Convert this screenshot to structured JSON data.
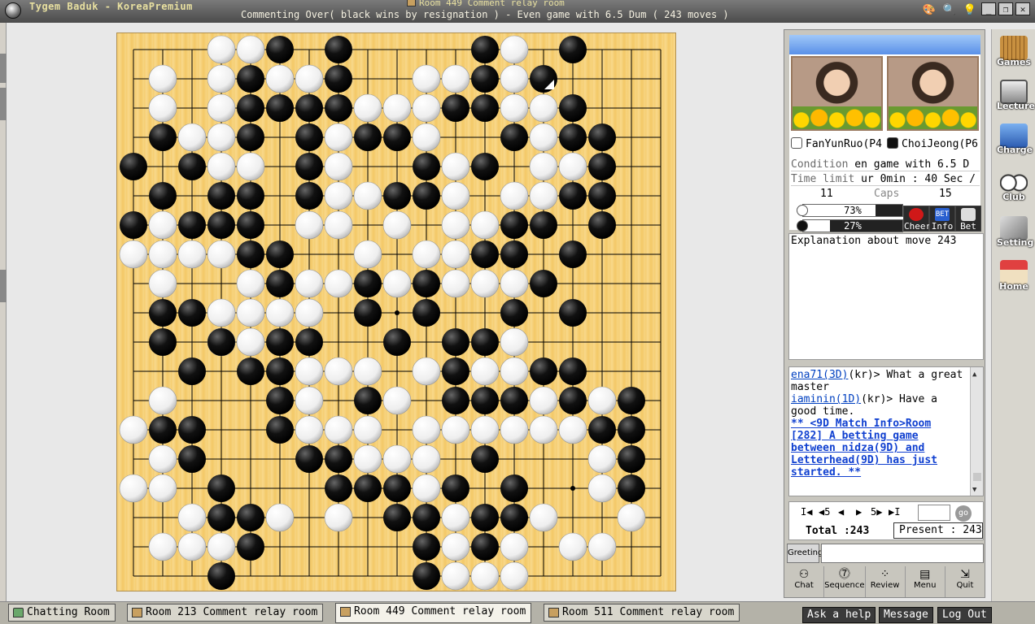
{
  "titlebar": {
    "app_title": "Tygem Baduk - KoreaPremium",
    "room_title": "Room 449 Comment relay room",
    "status": "Commenting Over( black wins by resignation ) - Even game with 6.5 Dum  ( 243 moves )"
  },
  "board": {
    "size": 19,
    "last_move": [
      14,
      1
    ],
    "black": [
      [
        5,
        0
      ],
      [
        7,
        0
      ],
      [
        12,
        0
      ],
      [
        15,
        0
      ],
      [
        4,
        1
      ],
      [
        7,
        1
      ],
      [
        12,
        1
      ],
      [
        14,
        1
      ],
      [
        4,
        2
      ],
      [
        5,
        2
      ],
      [
        6,
        2
      ],
      [
        7,
        2
      ],
      [
        11,
        2
      ],
      [
        12,
        2
      ],
      [
        15,
        2
      ],
      [
        1,
        3
      ],
      [
        4,
        3
      ],
      [
        6,
        3
      ],
      [
        8,
        3
      ],
      [
        9,
        3
      ],
      [
        13,
        3
      ],
      [
        15,
        3
      ],
      [
        16,
        3
      ],
      [
        0,
        4
      ],
      [
        2,
        4
      ],
      [
        6,
        4
      ],
      [
        10,
        4
      ],
      [
        12,
        4
      ],
      [
        16,
        4
      ],
      [
        1,
        5
      ],
      [
        3,
        5
      ],
      [
        4,
        5
      ],
      [
        6,
        5
      ],
      [
        9,
        5
      ],
      [
        10,
        5
      ],
      [
        15,
        5
      ],
      [
        16,
        5
      ],
      [
        0,
        6
      ],
      [
        2,
        6
      ],
      [
        3,
        6
      ],
      [
        4,
        6
      ],
      [
        13,
        6
      ],
      [
        14,
        6
      ],
      [
        16,
        6
      ],
      [
        4,
        7
      ],
      [
        5,
        7
      ],
      [
        12,
        7
      ],
      [
        13,
        7
      ],
      [
        15,
        7
      ],
      [
        5,
        8
      ],
      [
        8,
        8
      ],
      [
        10,
        8
      ],
      [
        14,
        8
      ],
      [
        1,
        9
      ],
      [
        2,
        9
      ],
      [
        8,
        9
      ],
      [
        10,
        9
      ],
      [
        13,
        9
      ],
      [
        15,
        9
      ],
      [
        1,
        10
      ],
      [
        3,
        10
      ],
      [
        5,
        10
      ],
      [
        6,
        10
      ],
      [
        9,
        10
      ],
      [
        11,
        10
      ],
      [
        12,
        10
      ],
      [
        2,
        11
      ],
      [
        4,
        11
      ],
      [
        5,
        11
      ],
      [
        11,
        11
      ],
      [
        14,
        11
      ],
      [
        15,
        11
      ],
      [
        5,
        12
      ],
      [
        8,
        12
      ],
      [
        11,
        12
      ],
      [
        12,
        12
      ],
      [
        13,
        12
      ],
      [
        15,
        12
      ],
      [
        17,
        12
      ],
      [
        1,
        13
      ],
      [
        2,
        13
      ],
      [
        5,
        13
      ],
      [
        16,
        13
      ],
      [
        17,
        13
      ],
      [
        2,
        14
      ],
      [
        6,
        14
      ],
      [
        7,
        14
      ],
      [
        12,
        14
      ],
      [
        17,
        14
      ],
      [
        3,
        15
      ],
      [
        7,
        15
      ],
      [
        8,
        15
      ],
      [
        9,
        15
      ],
      [
        11,
        15
      ],
      [
        13,
        15
      ],
      [
        17,
        15
      ],
      [
        3,
        16
      ],
      [
        4,
        16
      ],
      [
        9,
        16
      ],
      [
        10,
        16
      ],
      [
        12,
        16
      ],
      [
        13,
        16
      ],
      [
        4,
        17
      ],
      [
        10,
        17
      ],
      [
        12,
        17
      ],
      [
        3,
        18
      ],
      [
        10,
        18
      ]
    ],
    "white": [
      [
        3,
        0
      ],
      [
        4,
        0
      ],
      [
        13,
        0
      ],
      [
        1,
        1
      ],
      [
        3,
        1
      ],
      [
        5,
        1
      ],
      [
        6,
        1
      ],
      [
        10,
        1
      ],
      [
        11,
        1
      ],
      [
        13,
        1
      ],
      [
        1,
        2
      ],
      [
        3,
        2
      ],
      [
        8,
        2
      ],
      [
        9,
        2
      ],
      [
        10,
        2
      ],
      [
        13,
        2
      ],
      [
        14,
        2
      ],
      [
        2,
        3
      ],
      [
        3,
        3
      ],
      [
        7,
        3
      ],
      [
        10,
        3
      ],
      [
        14,
        3
      ],
      [
        3,
        4
      ],
      [
        4,
        4
      ],
      [
        7,
        4
      ],
      [
        11,
        4
      ],
      [
        14,
        4
      ],
      [
        15,
        4
      ],
      [
        7,
        5
      ],
      [
        8,
        5
      ],
      [
        11,
        5
      ],
      [
        13,
        5
      ],
      [
        14,
        5
      ],
      [
        1,
        6
      ],
      [
        6,
        6
      ],
      [
        7,
        6
      ],
      [
        9,
        6
      ],
      [
        11,
        6
      ],
      [
        12,
        6
      ],
      [
        0,
        7
      ],
      [
        1,
        7
      ],
      [
        2,
        7
      ],
      [
        3,
        7
      ],
      [
        8,
        7
      ],
      [
        10,
        7
      ],
      [
        11,
        7
      ],
      [
        1,
        8
      ],
      [
        4,
        8
      ],
      [
        6,
        8
      ],
      [
        7,
        8
      ],
      [
        9,
        8
      ],
      [
        11,
        8
      ],
      [
        12,
        8
      ],
      [
        13,
        8
      ],
      [
        3,
        9
      ],
      [
        4,
        9
      ],
      [
        5,
        9
      ],
      [
        6,
        9
      ],
      [
        3,
        10
      ],
      [
        4,
        10
      ],
      [
        13,
        10
      ],
      [
        6,
        11
      ],
      [
        7,
        11
      ],
      [
        8,
        11
      ],
      [
        10,
        11
      ],
      [
        12,
        11
      ],
      [
        13,
        11
      ],
      [
        1,
        12
      ],
      [
        6,
        12
      ],
      [
        9,
        12
      ],
      [
        14,
        12
      ],
      [
        16,
        12
      ],
      [
        0,
        13
      ],
      [
        6,
        13
      ],
      [
        7,
        13
      ],
      [
        8,
        13
      ],
      [
        10,
        13
      ],
      [
        11,
        13
      ],
      [
        12,
        13
      ],
      [
        13,
        13
      ],
      [
        14,
        13
      ],
      [
        15,
        13
      ],
      [
        1,
        14
      ],
      [
        8,
        14
      ],
      [
        9,
        14
      ],
      [
        10,
        14
      ],
      [
        16,
        14
      ],
      [
        0,
        15
      ],
      [
        1,
        15
      ],
      [
        10,
        15
      ],
      [
        16,
        15
      ],
      [
        2,
        16
      ],
      [
        5,
        16
      ],
      [
        7,
        16
      ],
      [
        11,
        16
      ],
      [
        14,
        16
      ],
      [
        17,
        16
      ],
      [
        1,
        17
      ],
      [
        2,
        17
      ],
      [
        3,
        17
      ],
      [
        11,
        17
      ],
      [
        13,
        17
      ],
      [
        15,
        17
      ],
      [
        16,
        17
      ],
      [
        11,
        18
      ],
      [
        12,
        18
      ],
      [
        13,
        18
      ]
    ]
  },
  "players": {
    "left_name": "FanYunRuo(P4",
    "right_name": "ChoiJeong(P6",
    "condition_label": "Condition",
    "condition_value": "en game with 6.5 D",
    "time_label": "Time limit",
    "time_value": "ur 0min : 40 Sec /",
    "left_caps": "11",
    "caps_label": "Caps",
    "right_caps": "15",
    "left_pct": "73%",
    "right_pct": "27%",
    "left_pct_value": 73,
    "right_pct_value": 27,
    "cheer_label": "Cheer",
    "info_label": "Info",
    "info_badge": "BET",
    "bet_label": "Bet"
  },
  "explanation": "Explanation about move 243",
  "chat": {
    "line1_user": "ena71(3D)",
    "line1_text": "(kr)> What a great master",
    "line2_user": "iaminin(1D)",
    "line2_text": "(kr)> Have a good time.",
    "line3": "** <9D Match Info>Room [282] A betting game between nidza(9D) and Letterhead(9D) has just started. **"
  },
  "nav": {
    "first": "I◀",
    "back5": "◀5",
    "prev": "◀",
    "next": "▶",
    "fwd5": "5▶",
    "last": "▶I",
    "go": "go",
    "total": "Total :243",
    "present": "Present : 243"
  },
  "greeting": {
    "label": "Greeting"
  },
  "tools": [
    "Chat",
    "Sequence",
    "Review",
    "Menu",
    "Quit"
  ],
  "rightbar": [
    "Games",
    "Lecture",
    "Charge",
    "Club",
    "Setting",
    "Home"
  ],
  "taskbar": {
    "tabs": [
      "Chatting Room",
      "Room 213 Comment relay room",
      "Room 449 Comment relay room",
      "Room 511 Comment relay room"
    ],
    "ask": "Ask a help",
    "message": "Message",
    "logout": "Log Out"
  },
  "colors": {
    "board": "#f5cd70",
    "title_text": "#e8e0a0",
    "link": "#0040c0"
  }
}
